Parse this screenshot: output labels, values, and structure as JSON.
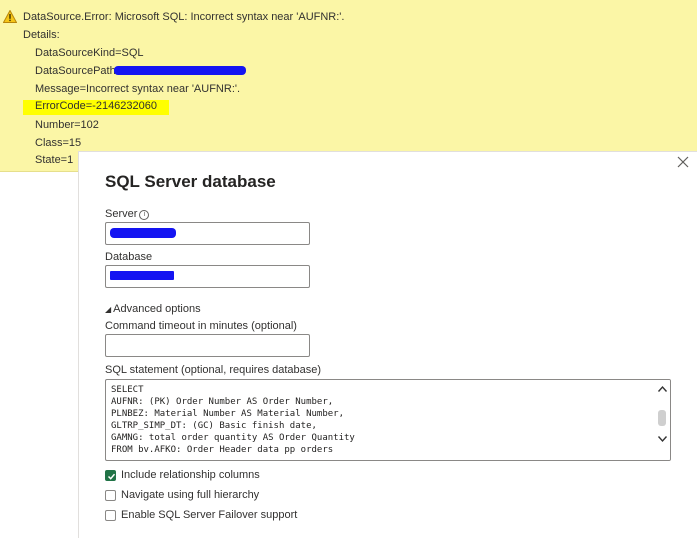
{
  "error": {
    "title": "DataSource.Error: Microsoft SQL: Incorrect syntax near 'AUFNR:'.",
    "details_label": "Details:",
    "lines": [
      "DataSourceKind=SQL",
      "DataSourcePath=",
      "Message=Incorrect syntax near 'AUFNR:'.",
      "ErrorCode=-2146232060",
      "Number=102",
      "Class=15",
      "State=1"
    ],
    "highlight_color": "#ffff00",
    "banner_color": "#fbf6a6"
  },
  "dialog": {
    "title": "SQL Server database",
    "close_icon": "close-icon",
    "server_label": "Server",
    "server_value": "",
    "database_label": "Database",
    "database_value": "",
    "advanced_label": "Advanced options",
    "timeout_label": "Command timeout in minutes (optional)",
    "timeout_value": "",
    "sql_label": "SQL statement (optional, requires database)",
    "sql_lines": [
      "SELECT",
      "AUFNR: (PK) Order Number AS Order Number,",
      "PLNBEZ: Material Number AS Material Number,",
      "GLTRP_SIMP_DT: (GC) Basic finish date,",
      "GAMNG: total order quantity AS Order Quantity",
      "FROM bv.AFKO: Order Header data pp orders"
    ],
    "checkboxes": [
      {
        "label": "Include relationship columns",
        "checked": true
      },
      {
        "label": "Navigate using full hierarchy",
        "checked": false
      },
      {
        "label": "Enable SQL Server Failover support",
        "checked": false
      }
    ],
    "check_color": "#217346",
    "redaction_color": "#1414f2"
  }
}
